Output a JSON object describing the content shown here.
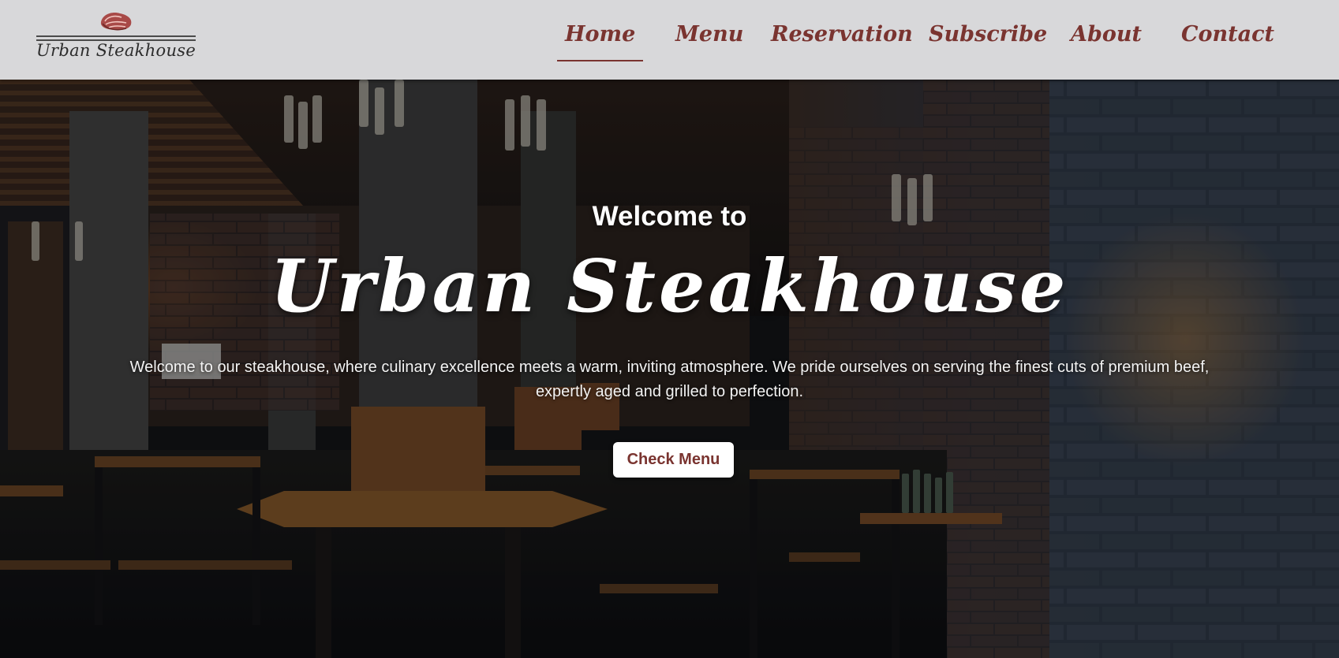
{
  "site": {
    "brand_name": "Urban Steakhouse",
    "logo_icon": "steak-icon",
    "accent_color": "#7a3430",
    "header_bg": "#d8d8da"
  },
  "nav": {
    "items": [
      {
        "label": "Home",
        "active": true
      },
      {
        "label": "Menu",
        "active": false
      },
      {
        "label": "Reservation",
        "active": false
      },
      {
        "label": "Subscribe",
        "active": false
      },
      {
        "label": "About",
        "active": false
      },
      {
        "label": "Contact",
        "active": false
      }
    ]
  },
  "hero": {
    "welcome": "Welcome to",
    "title": "Urban Steakhouse",
    "description": "Welcome to our steakhouse, where culinary excellence meets a warm, inviting atmosphere. We pride ourselves on serving the finest cuts of premium beef, expertly aged and grilled to perfection.",
    "cta_label": "Check Menu",
    "background": "restaurant-interior-image"
  }
}
